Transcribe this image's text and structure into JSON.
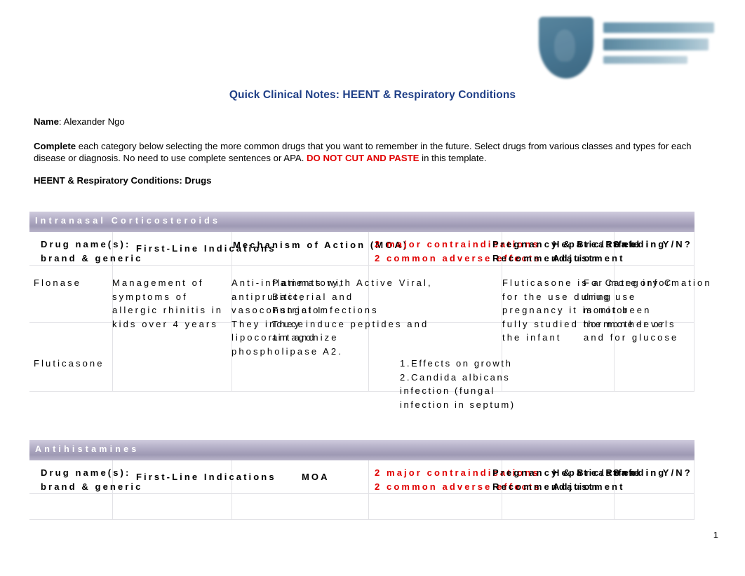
{
  "document": {
    "title": "Quick Clinical Notes: HEENT & Respiratory Conditions",
    "name_label": "Name",
    "name_value": ": Alexander Ngo",
    "instructions_lead": "Complete",
    "instructions_body": " each category below selecting the more common drugs that you want to remember in the future. Select drugs from various classes and types for each disease or diagnosis. No need to use complete sentences or APA. ",
    "instructions_warning": "DO NOT CUT AND PASTE",
    "instructions_tail": " in this template.",
    "section_heading": "HEENT & Respiratory Conditions: Drugs",
    "page_number": "1",
    "title_color": "#1f3f87",
    "warning_color": "#e00000",
    "category_bar_color": "#9e99b4"
  },
  "logo": {
    "name": "university-logo"
  },
  "tables": [
    {
      "category": "Intranasal Corticosteroids",
      "headers": {
        "drug_name": "Drug name(s):\nbrand & generic",
        "first_line": "First-Line Indications",
        "moa": "Mechanism of Action (MOA)",
        "contraindications": "2 major contraindications\n2 common adverse effects",
        "pregnancy": "Pregnancy & Breastfeeding\nRecommendation",
        "hepatic_renal": "Hepatic/Renal\nAdjustment",
        "safe": "Safe in Y/N?"
      },
      "rows": [
        {
          "drug": "Flonase",
          "indications": "Management of\nsymptoms of\nallergic rhinitis in\nkids over 4 years",
          "moa": "Anti-inflammatory,\nantipruritic,\nvasoconstrictor.\nThey induce\nlipocortin and\nphospholipase A2.",
          "contra_adverse": "Patients with Active Viral,\nBacterial and\nFungal Infections\nThey induce peptides and\nantagonize",
          "pregnancy": "Fluticasone is a Category C\nfor the use during\npregnancy it is not been\nfully studied the mother or\nthe infant",
          "hepatic_renal": "For more information\ndrug use\nmonitor\nhormone levels\nand for glucose",
          "safe": ""
        },
        {
          "drug": "Fluticasone",
          "indications": "",
          "moa": "",
          "contra_adverse": "1.Effects on growth\n2.Candida albicans\n   infection (fungal\n   infection in septum)",
          "pregnancy": "",
          "hepatic_renal": "",
          "safe": ""
        }
      ]
    },
    {
      "category": "Antihistamines",
      "headers": {
        "drug_name": "Drug name(s):\nbrand & generic",
        "first_line": "First-Line Indications",
        "moa": "MOA",
        "contraindications": "2 major contraindications\n2 common adverse effects",
        "pregnancy": "Pregnancy & Breastfeeding\nRecommendation",
        "hepatic_renal": "Hepatic/Renal\nAdjustment",
        "safe": "Safe in Y/N?"
      },
      "rows": [
        {
          "drug": "",
          "indications": "",
          "moa": "",
          "contra_adverse": "",
          "pregnancy": "",
          "hepatic_renal": "",
          "safe": ""
        }
      ]
    }
  ]
}
